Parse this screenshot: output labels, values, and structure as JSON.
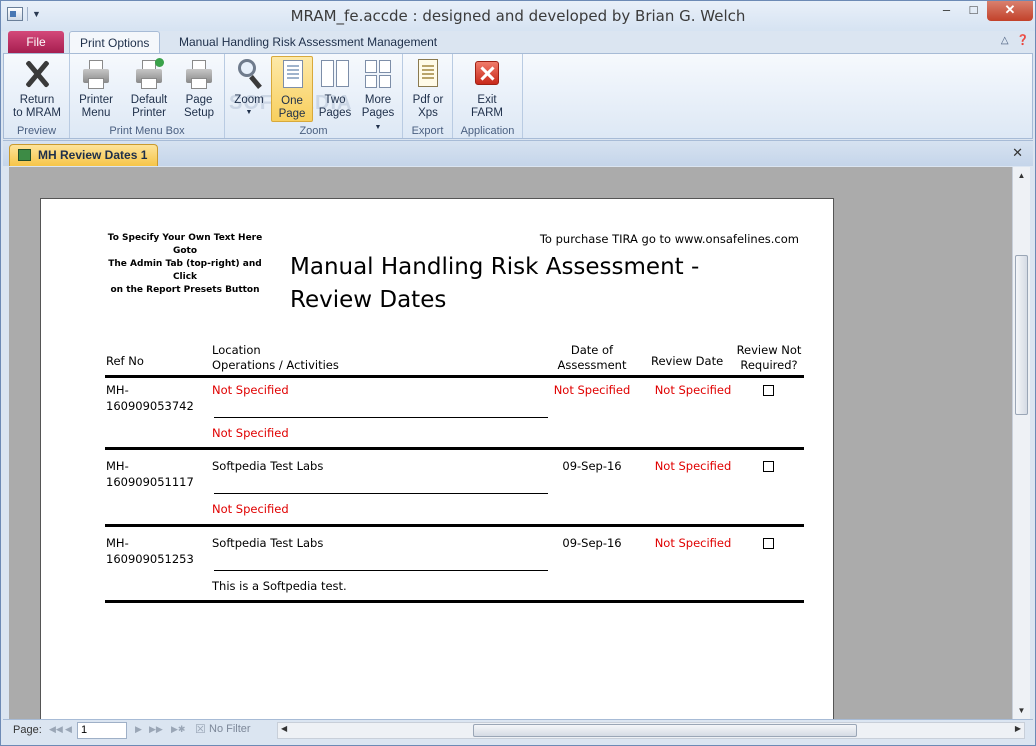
{
  "window": {
    "title": "MRAM_fe.accde : designed and developed by Brian G. Welch",
    "minimize": "–",
    "maximize": "□",
    "close": "✕"
  },
  "ribbon_tabs": {
    "file": "File",
    "print_options": "Print Options",
    "management": "Manual Handling Risk Assessment Management"
  },
  "ribbon": {
    "groups": {
      "preview": "Preview",
      "print_menu_box": "Print Menu Box",
      "zoom": "Zoom",
      "export": "Export",
      "application": "Application"
    },
    "buttons": {
      "return_l1": "Return",
      "return_l2": "to MRAM",
      "printer_l1": "Printer",
      "printer_l2": "Menu",
      "default_l1": "Default",
      "default_l2": "Printer",
      "setup_l1": "Page",
      "setup_l2": "Setup",
      "zoom_l1": "Zoom",
      "one_l1": "One",
      "one_l2": "Page",
      "two_l1": "Two",
      "two_l2": "Pages",
      "more_l1": "More",
      "more_l2": "Pages",
      "pdf_l1": "Pdf or",
      "pdf_l2": "Xps",
      "exit_l1": "Exit",
      "exit_l2": "FARM"
    },
    "watermark": "SOFTPEDIA"
  },
  "document_tab": {
    "label": "MH Review Dates 1",
    "close": "✕"
  },
  "report": {
    "note_l1": "To Specify Your Own Text Here Goto",
    "note_l2": "The Admin Tab (top-right) and Click",
    "note_l3": "on the Report Presets Button",
    "purchase": "To purchase TIRA go to www.onsafelines.com",
    "title_l1": "Manual Handling Risk Assessment -",
    "title_l2": "Review Dates",
    "headers": {
      "ref_no": "Ref No",
      "location_l1": "Location",
      "location_l2": "Operations / Activities",
      "date_l1": "Date of",
      "date_l2": "Assessment",
      "review_date": "Review Date",
      "not_req_l1": "Review Not",
      "not_req_l2": "Required?"
    },
    "rows": [
      {
        "ref_l1": "MH-",
        "ref_l2": "160909053742",
        "location": "Not Specified",
        "activities": "Not Specified",
        "date": "Not Specified",
        "review": "Not Specified"
      },
      {
        "ref_l1": "MH-",
        "ref_l2": "160909051117",
        "location": "Softpedia Test Labs",
        "activities": "Not Specified",
        "date": "09-Sep-16",
        "review": "Not Specified"
      },
      {
        "ref_l1": "MH-",
        "ref_l2": "160909051253",
        "location": "Softpedia Test Labs",
        "activities": "This is a Softpedia test.",
        "date": "09-Sep-16",
        "review": "Not Specified"
      }
    ]
  },
  "navbar": {
    "page_label": "Page:",
    "page_value": "1",
    "no_filter": "No Filter"
  },
  "colors": {
    "file_tab": "#c0285e",
    "not_specified": "#e00000",
    "selected_button": "#f8cf5e"
  }
}
